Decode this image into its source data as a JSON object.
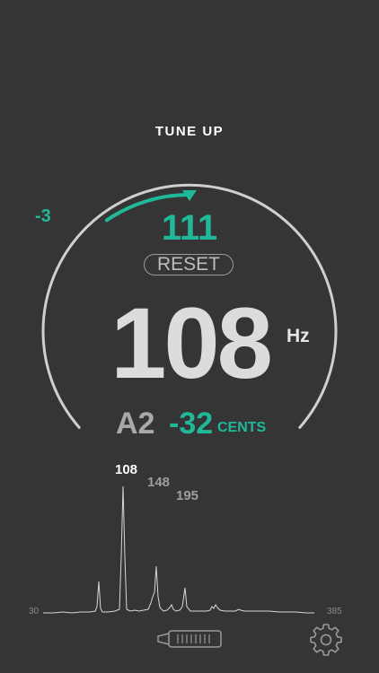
{
  "app": {
    "title": "TUNE UP"
  },
  "tuner": {
    "offset": "-3",
    "reference_frequency": "111",
    "reset_label": "RESET",
    "frequency": "108",
    "frequency_unit": "Hz",
    "note": "A2",
    "cents": "-32",
    "cents_unit": "CENTS",
    "arc_accent_fraction": 0.3
  },
  "spectrum": {
    "peaks": [
      "108",
      "148",
      "195"
    ],
    "axis_min": "30",
    "axis_max": "385"
  },
  "icons": {
    "indicator": "triangle-down-icon",
    "slider": "slider-handle-icon",
    "settings": "gear-icon"
  },
  "colors": {
    "background": "#353535",
    "accent": "#1fb99a",
    "arc": "#cfcfcf",
    "text_primary": "#dcdcdc",
    "text_muted": "#a9a9a9"
  }
}
